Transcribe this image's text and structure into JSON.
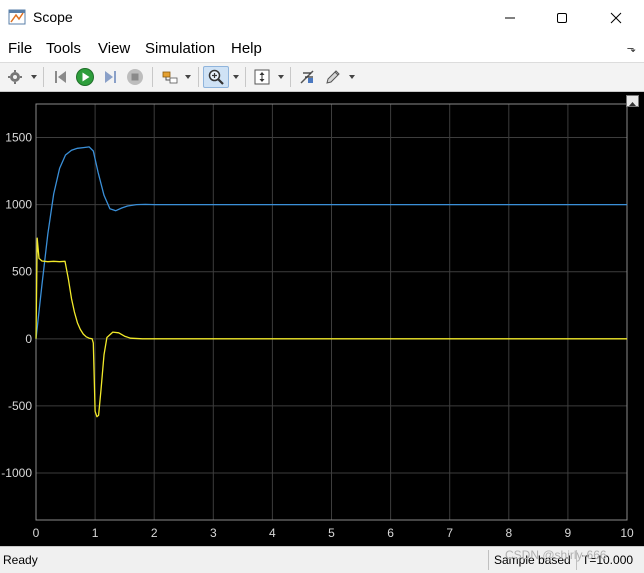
{
  "window": {
    "title": "Scope",
    "controls": [
      "minimize",
      "maximize",
      "close"
    ]
  },
  "menu": {
    "items": [
      "File",
      "Tools",
      "View",
      "Simulation",
      "Help"
    ]
  },
  "toolbar": {
    "buttons": [
      {
        "icon": "gear-icon"
      },
      {
        "icon": "step-back-icon"
      },
      {
        "icon": "run-icon"
      },
      {
        "icon": "step-forward-icon"
      },
      {
        "icon": "stop-icon"
      },
      {
        "icon": "highlight-block-icon"
      },
      {
        "icon": "zoom-icon",
        "active": true
      },
      {
        "icon": "scale-axes-icon"
      },
      {
        "icon": "cursor-measurements-icon"
      },
      {
        "icon": "edit-icon"
      }
    ],
    "colors": {
      "run": "#2e9e3c",
      "zoom_active_bg": "#cfe2f5"
    }
  },
  "status": {
    "ready": "Ready",
    "sample_mode": "Sample based",
    "time": "T=10.000"
  },
  "watermark": "CSDN @shirly-666",
  "chart_data": {
    "type": "line",
    "background": "#000000",
    "grid": true,
    "xlim": [
      0,
      10
    ],
    "ylim": [
      -1350,
      1750
    ],
    "x_ticks": [
      0,
      1,
      2,
      3,
      4,
      5,
      6,
      7,
      8,
      9,
      10
    ],
    "y_ticks": [
      -1000,
      -500,
      0,
      500,
      1000,
      1500
    ],
    "x_tick_labels": [
      "0",
      "1",
      "2",
      "3",
      "4",
      "5",
      "6",
      "7",
      "8",
      "9",
      "10"
    ],
    "y_tick_labels": [
      "-1000",
      "-500",
      "0",
      "500",
      "1000",
      "1500"
    ],
    "series": [
      {
        "color": "#3a8fd8",
        "x": [
          0,
          0.1,
          0.2,
          0.3,
          0.4,
          0.5,
          0.6,
          0.7,
          0.8,
          0.9,
          0.97,
          1.05,
          1.15,
          1.25,
          1.35,
          1.45,
          1.55,
          1.7,
          1.85,
          2.0,
          3,
          4,
          5,
          6,
          7,
          8,
          9,
          10
        ],
        "y": [
          0,
          400,
          780,
          1080,
          1270,
          1370,
          1405,
          1420,
          1425,
          1430,
          1400,
          1240,
          1070,
          970,
          955,
          975,
          990,
          1000,
          1002,
          1000,
          1000,
          1000,
          1000,
          1000,
          1000,
          1000,
          1000,
          1000
        ]
      },
      {
        "color": "#f2ea2a",
        "x": [
          0,
          0.02,
          0.05,
          0.1,
          0.2,
          0.3,
          0.4,
          0.49,
          0.55,
          0.6,
          0.65,
          0.7,
          0.75,
          0.8,
          0.85,
          0.9,
          0.95,
          0.97,
          0.98,
          1.0,
          1.03,
          1.06,
          1.1,
          1.15,
          1.2,
          1.3,
          1.4,
          1.5,
          1.6,
          1.8,
          2.0,
          3,
          4,
          5,
          6,
          7,
          8,
          9,
          10
        ],
        "y": [
          0,
          750,
          600,
          580,
          575,
          578,
          575,
          578,
          440,
          300,
          200,
          120,
          70,
          35,
          15,
          5,
          0,
          -30,
          -200,
          -540,
          -580,
          -570,
          -380,
          -120,
          10,
          50,
          45,
          20,
          5,
          0,
          0,
          0,
          0,
          0,
          0,
          0,
          0,
          0,
          0
        ]
      }
    ]
  }
}
